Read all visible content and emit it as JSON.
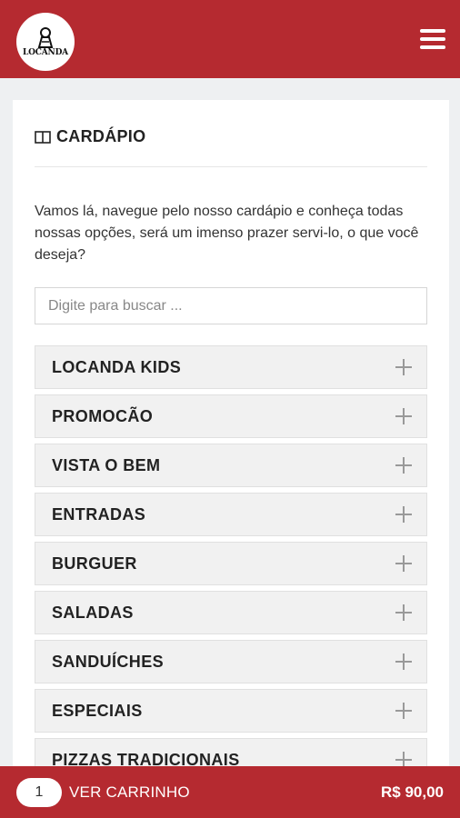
{
  "header": {
    "logo_text": "LOCANDA",
    "brand_color": "#b52a30"
  },
  "menu_section": {
    "title": "CARDÁPIO",
    "intro": "Vamos lá, navegue pelo nosso cardápio e conheça todas nossas opções, será um imenso prazer servi-lo, o que você deseja?",
    "search_placeholder": "Digite para buscar ..."
  },
  "categories": [
    {
      "label": "LOCANDA KIDS"
    },
    {
      "label": "PROMOCÃO"
    },
    {
      "label": "VISTA O BEM"
    },
    {
      "label": "ENTRADAS"
    },
    {
      "label": "BURGUER"
    },
    {
      "label": "SALADAS"
    },
    {
      "label": "SANDUÍCHES"
    },
    {
      "label": "ESPECIAIS"
    },
    {
      "label": "PIZZAS TRADICIONAIS"
    }
  ],
  "cart": {
    "count": "1",
    "label": "VER CARRINHO",
    "total": "R$ 90,00"
  }
}
